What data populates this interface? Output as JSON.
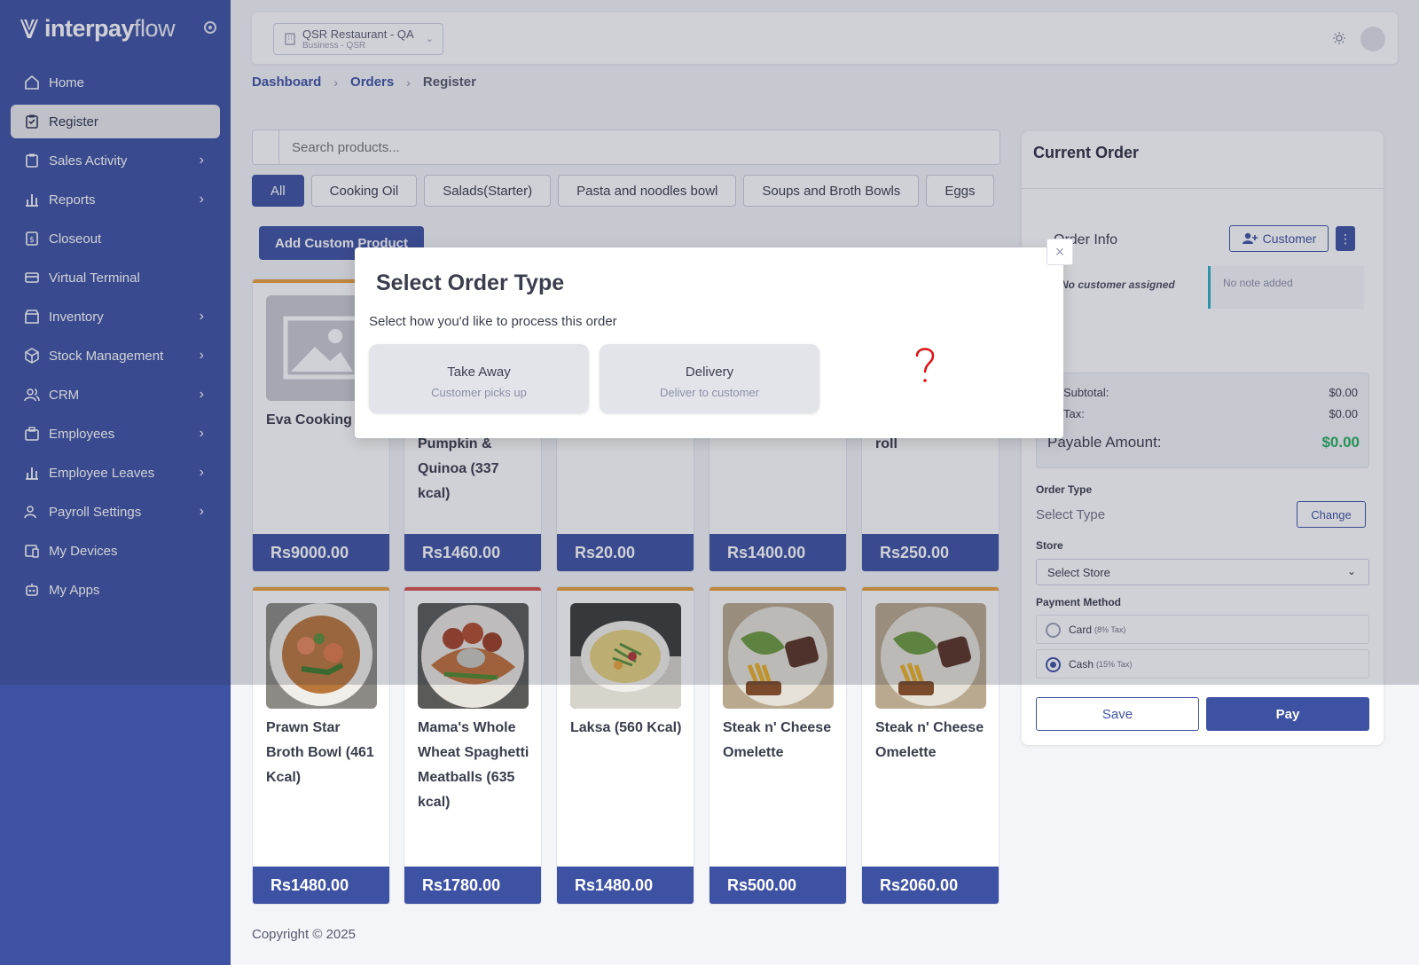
{
  "brand": {
    "name_bold": "interpay",
    "name_light": "flow"
  },
  "sidebar": {
    "items": [
      {
        "label": "Home",
        "icon": "home-icon",
        "has_children": false
      },
      {
        "label": "Register",
        "icon": "register-icon",
        "has_children": false,
        "active": true
      },
      {
        "label": "Sales Activity",
        "icon": "sales-icon",
        "has_children": true
      },
      {
        "label": "Reports",
        "icon": "reports-icon",
        "has_children": true
      },
      {
        "label": "Closeout",
        "icon": "closeout-icon",
        "has_children": false
      },
      {
        "label": "Virtual Terminal",
        "icon": "terminal-icon",
        "has_children": false
      },
      {
        "label": "Inventory",
        "icon": "inventory-icon",
        "has_children": true
      },
      {
        "label": "Stock Management",
        "icon": "stock-icon",
        "has_children": true
      },
      {
        "label": "CRM",
        "icon": "crm-icon",
        "has_children": true
      },
      {
        "label": "Employees",
        "icon": "employees-icon",
        "has_children": true
      },
      {
        "label": "Employee Leaves",
        "icon": "leaves-icon",
        "has_children": true
      },
      {
        "label": "Payroll Settings",
        "icon": "payroll-icon",
        "has_children": true
      },
      {
        "label": "My Devices",
        "icon": "devices-icon",
        "has_children": false
      },
      {
        "label": "My Apps",
        "icon": "apps-icon",
        "has_children": false
      }
    ]
  },
  "topbar": {
    "business_name": "QSR Restaurant - QA",
    "business_sub": "Business - QSR"
  },
  "breadcrumb": {
    "items": [
      "Dashboard",
      "Orders"
    ],
    "current": "Register"
  },
  "search": {
    "placeholder": "Search products..."
  },
  "categories": [
    "All",
    "Cooking Oil",
    "Salads(Starter)",
    "Pasta and noodles bowl",
    "Soups and Broth Bowls",
    "Eggs"
  ],
  "add_custom_label": "Add Custom Product",
  "products_row1": [
    {
      "name": "Eva Cooking O",
      "price": "Rs9000.00",
      "accent": "#e9a13b"
    },
    {
      "name": "Pumpkin & Quinoa (337 kcal)",
      "price": "Rs1460.00",
      "accent": "#e9a13b"
    },
    {
      "name": "",
      "price": "Rs20.00",
      "accent": "#e9a13b"
    },
    {
      "name": "",
      "price": "Rs1400.00",
      "accent": "#e9a13b"
    },
    {
      "name": "roll",
      "price": "Rs250.00",
      "accent": "#e9a13b"
    }
  ],
  "products_row2": [
    {
      "name": "Prawn Star Broth Bowl (461 Kcal)",
      "price": "Rs1480.00",
      "accent": "#e9a13b"
    },
    {
      "name": "Mama's Whole Wheat Spaghetti Meatballs (635 kcal)",
      "price": "Rs1780.00",
      "accent": "#d9534f"
    },
    {
      "name": "Laksa (560 Kcal)",
      "price": "Rs1480.00",
      "accent": "#e9a13b"
    },
    {
      "name": "Steak n' Cheese Omelette",
      "price": "Rs500.00",
      "accent": "#e9a13b"
    },
    {
      "name": "Steak n' Cheese Omelette",
      "price": "Rs2060.00",
      "accent": "#e9a13b"
    }
  ],
  "order": {
    "title": "Current Order",
    "info_title": "Order Info",
    "customer_button": "Customer",
    "no_customer": "No customer assigned",
    "no_note": "No note added",
    "subtotal_label": "Subtotal:",
    "subtotal": "$0.00",
    "tax_label": "Tax:",
    "tax": "$0.00",
    "payable_label": "Payable Amount:",
    "payable": "$0.00",
    "order_type_label": "Order Type",
    "order_type_value": "Select Type",
    "change_label": "Change",
    "store_label": "Store",
    "store_value": "Select Store",
    "payment_label": "Payment Method",
    "payment_card": "Card",
    "payment_card_tax": "(8% Tax)",
    "payment_cash": "Cash",
    "payment_cash_tax": "(15% Tax)",
    "save_label": "Save",
    "pay_label": "Pay"
  },
  "modal": {
    "title": "Select Order Type",
    "subtitle": "Select how you'd like to process this order",
    "options": [
      {
        "title": "Take Away",
        "sub": "Customer picks up"
      },
      {
        "title": "Delivery",
        "sub": "Deliver to customer"
      }
    ]
  },
  "footer": {
    "copyright": "Copyright © 2025"
  },
  "colors": {
    "primary": "#3e52a3",
    "success": "#27ae60",
    "accent": "#e9a13b"
  }
}
